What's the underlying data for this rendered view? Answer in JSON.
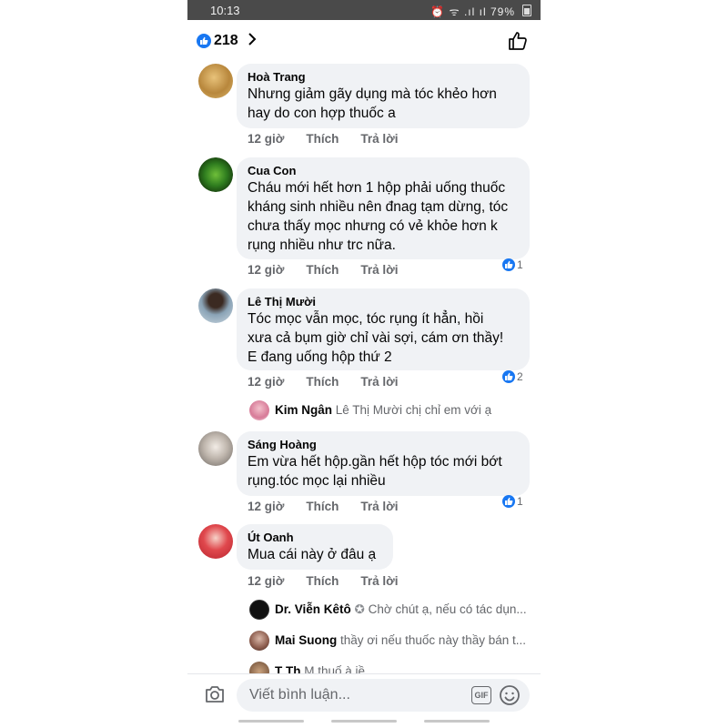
{
  "status_bar": {
    "time": "10:13",
    "icons": "⏰ ᯤ .ıl ıl",
    "battery": "79%"
  },
  "header": {
    "reaction_count": "218",
    "colors": {
      "accent": "#1877f2"
    }
  },
  "comments": [
    {
      "author": "Hoà Trang",
      "text": "Nhưng giảm gãy dụng mà tóc khẻo hơn\nhay do con hợp thuốc a",
      "time": "12 giờ",
      "like": "Thích",
      "reply": "Trả lời",
      "reactions": ""
    },
    {
      "author": "Cua Con",
      "text": "Cháu mới hết hơn 1 hộp phải uống thuốc\nkháng sinh nhiều nên đnag tạm dừng, tóc\nchưa thấy mọc nhưng có vẻ khỏe hơn k\nrụng nhiều như trc nữa.",
      "time": "12 giờ",
      "like": "Thích",
      "reply": "Trả lời",
      "reactions": "1"
    },
    {
      "author": "Lê Thị Mười",
      "text": "Tóc mọc vẫn mọc, tóc rụng ít hẳn, hồi\nxưa cả bụm giờ chỉ vài sợi, cám ơn thầy!\nE đang uống hộp thứ 2",
      "time": "12 giờ",
      "like": "Thích",
      "reply": "Trả lời",
      "reactions": "2",
      "replies": [
        {
          "name": "Kim Ngân",
          "text": "Lê Thị Mười chị chỉ em với ạ"
        }
      ]
    },
    {
      "author": "Sáng Hoàng",
      "text": "Em vừa hết hộp.gần hết hộp tóc mới bớt\nrụng.tóc mọc lại nhiều",
      "time": "12 giờ",
      "like": "Thích",
      "reply": "Trả lời",
      "reactions": "1"
    },
    {
      "author": "Út Oanh",
      "text": "Mua cái này ở đâu ạ",
      "time": "12 giờ",
      "like": "Thích",
      "reply": "Trả lời",
      "reactions": "",
      "replies": [
        {
          "name": "Dr. Viễn Kêtô",
          "text": "Chờ chút ạ, nếu có tác dụn..."
        },
        {
          "name": "Mai Suong",
          "text": "thầy ơi nếu thuốc này thầy bán t..."
        },
        {
          "name": "T  Th",
          "text": "M   thuố   à  iề"
        }
      ]
    }
  ],
  "composer": {
    "placeholder": "Viết bình luận...",
    "gif_label": "GIF"
  }
}
